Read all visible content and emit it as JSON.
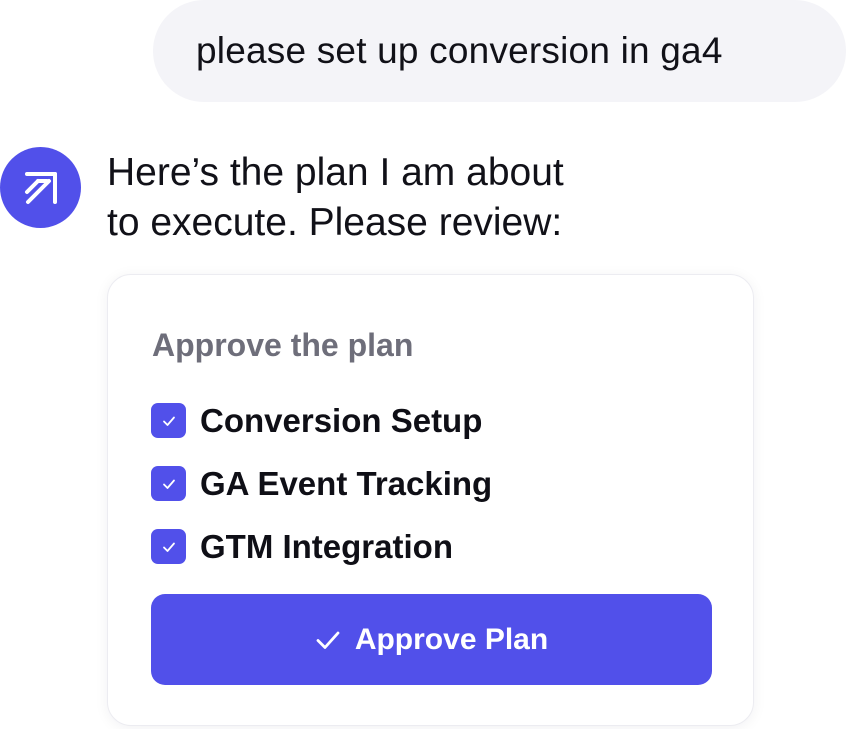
{
  "user_message": {
    "text": "please set up conversion in ga4"
  },
  "assistant": {
    "avatar_icon": "arrow-up-right-icon",
    "message_lines": [
      "Here’s the plan I am about",
      "to execute. Please review:"
    ]
  },
  "plan_card": {
    "title": "Approve the plan",
    "items": [
      {
        "label": "Conversion Setup",
        "checked": true
      },
      {
        "label": "GA Event Tracking",
        "checked": true
      },
      {
        "label": "GTM Integration",
        "checked": true
      }
    ],
    "approve_button": {
      "label": "Approve Plan",
      "icon": "checkmark-icon"
    }
  },
  "colors": {
    "accent": "#5150ea",
    "user_bubble_bg": "#f4f4f8",
    "card_title": "#6e6e7a",
    "text": "#111118"
  }
}
